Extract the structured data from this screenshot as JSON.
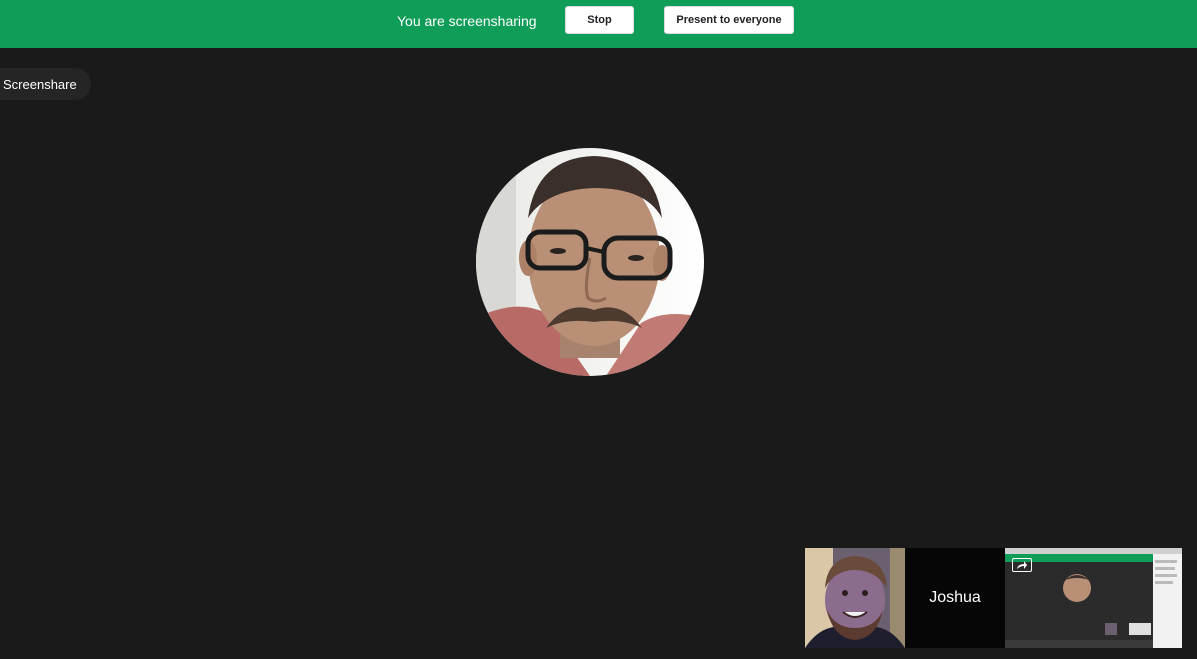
{
  "banner": {
    "message": "You are screensharing",
    "stop_label": "Stop",
    "present_label": "Present to everyone",
    "color": "#0f9d58"
  },
  "stage": {
    "chip_label": "Screenshare",
    "background": "#1a1a1a"
  },
  "filmstrip": {
    "participant_name": "Joshua",
    "share_icon": "share-screen-icon"
  }
}
